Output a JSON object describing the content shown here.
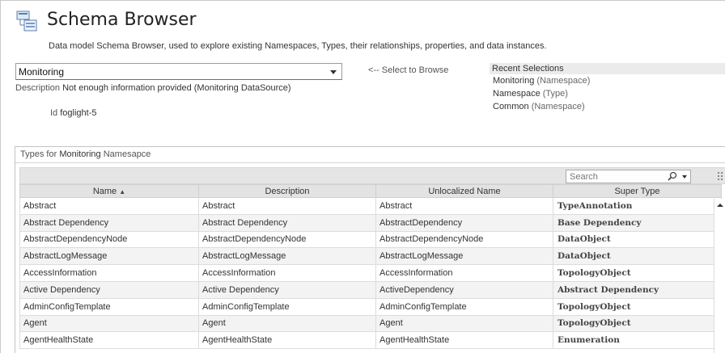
{
  "header": {
    "title": "Schema Browser",
    "subtitle": "Data model Schema Browser, used to explore existing Namespaces, Types, their relationships, properties, and data instances."
  },
  "namespace_select": {
    "value": "Monitoring",
    "hint": "<-- Select to Browse"
  },
  "details": {
    "description_label": "Description",
    "description_value": "Not enough information provided (Monitoring DataSource)",
    "id_label": "Id",
    "id_value": "foglight-5"
  },
  "recent": {
    "title": "Recent Selections",
    "items": [
      {
        "name": "Monitoring",
        "type": "(Namespace)"
      },
      {
        "name": "Namespace",
        "type": "(Type)"
      },
      {
        "name": "Common",
        "type": "(Namespace)"
      }
    ]
  },
  "types_panel": {
    "title_prefix": "Types for",
    "namespace": "Monitoring",
    "title_suffix": "Namesapce",
    "search_placeholder": "Search",
    "columns": [
      "Name",
      "Description",
      "Unlocalized Name",
      "Super Type"
    ],
    "sort_indicator": "▲",
    "rows": [
      [
        "Abstract",
        "Abstract",
        "Abstract",
        "TypeAnnotation"
      ],
      [
        "Abstract Dependency",
        "Abstract Dependency",
        "AbstractDependency",
        "Base Dependency"
      ],
      [
        "AbstractDependencyNode",
        "AbstractDependencyNode",
        "AbstractDependencyNode",
        "DataObject"
      ],
      [
        "AbstractLogMessage",
        "AbstractLogMessage",
        "AbstractLogMessage",
        "DataObject"
      ],
      [
        "AccessInformation",
        "AccessInformation",
        "AccessInformation",
        "TopologyObject"
      ],
      [
        "Active Dependency",
        "Active Dependency",
        "ActiveDependency",
        "Abstract Dependency"
      ],
      [
        "AdminConfigTemplate",
        "AdminConfigTemplate",
        "AdminConfigTemplate",
        "TopologyObject"
      ],
      [
        "Agent",
        "Agent",
        "Agent",
        "TopologyObject"
      ],
      [
        "AgentHealthState",
        "AgentHealthState",
        "AgentHealthState",
        "Enumeration"
      ]
    ]
  }
}
